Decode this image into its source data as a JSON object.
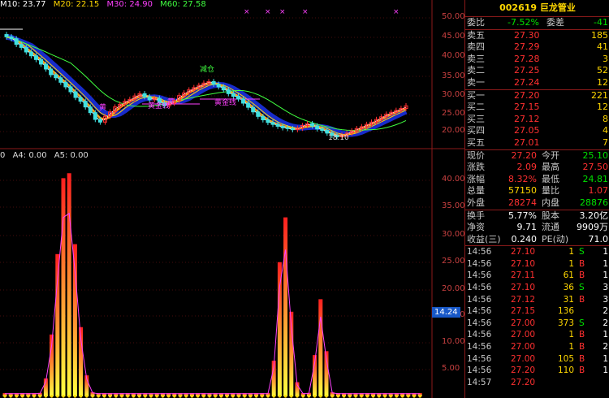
{
  "ma_legend": [
    {
      "text": "M10: 23.77",
      "color": "#ffffff"
    },
    {
      "text": "M20: 22.15",
      "color": "#ffd700"
    },
    {
      "text": "M30: 24.90",
      "color": "#ff40ff"
    },
    {
      "text": "M60: 27.58",
      "color": "#40ff40"
    }
  ],
  "indicator_legend": [
    {
      "text": "0",
      "color": "#dddddd"
    },
    {
      "text": "A4: 0.00",
      "color": "#dddddd"
    },
    {
      "text": "A5: 0.00",
      "color": "#dddddd"
    }
  ],
  "price_axis": [
    "50.00",
    "45.00",
    "40.00",
    "35.00",
    "30.00",
    "25.00",
    "20.00"
  ],
  "indicator_axis": [
    "40.00",
    "35.00",
    "30.00",
    "25.00",
    "20.00",
    "15.00",
    "10.00",
    "5.00"
  ],
  "cursor_value": "14.24",
  "annotations": {
    "sell_mark": "减仓",
    "gold_a": "黄金线",
    "gold_b": "黄金线",
    "short_a": "黄",
    "short_b": "黄",
    "low_price": "18.10"
  },
  "stock": {
    "code": "002619",
    "name": "巨龙管业"
  },
  "commission": {
    "ratio_label": "委比",
    "ratio_value": "-7.52%",
    "diff_label": "委差",
    "diff_value": "-41"
  },
  "asks": [
    {
      "label": "卖五",
      "price": "27.30",
      "vol": "185"
    },
    {
      "label": "卖四",
      "price": "27.29",
      "vol": "41"
    },
    {
      "label": "卖三",
      "price": "27.28",
      "vol": "3"
    },
    {
      "label": "卖二",
      "price": "27.25",
      "vol": "52"
    },
    {
      "label": "卖一",
      "price": "27.24",
      "vol": "12"
    }
  ],
  "bids": [
    {
      "label": "买一",
      "price": "27.20",
      "vol": "221"
    },
    {
      "label": "买二",
      "price": "27.15",
      "vol": "12"
    },
    {
      "label": "买三",
      "price": "27.12",
      "vol": "8"
    },
    {
      "label": "买四",
      "price": "27.05",
      "vol": "4"
    },
    {
      "label": "买五",
      "price": "27.01",
      "vol": "7"
    }
  ],
  "quote": [
    {
      "l1": "现价",
      "v1": "27.20",
      "c1": "red",
      "l2": "今开",
      "v2": "25.10",
      "c2": "green"
    },
    {
      "l1": "涨跌",
      "v1": "2.09",
      "c1": "red",
      "l2": "最高",
      "v2": "27.50",
      "c2": "red"
    },
    {
      "l1": "涨幅",
      "v1": "8.32%",
      "c1": "red",
      "l2": "最低",
      "v2": "24.81",
      "c2": "green"
    },
    {
      "l1": "总量",
      "v1": "57150",
      "c1": "yellow",
      "l2": "量比",
      "v2": "1.07",
      "c2": "red"
    },
    {
      "l1": "外盘",
      "v1": "28274",
      "c1": "red",
      "l2": "内盘",
      "v2": "28876",
      "c2": "green"
    }
  ],
  "fundamentals": [
    {
      "l1": "换手",
      "v1": "5.77%",
      "l2": "股本",
      "v2": "3.20亿"
    },
    {
      "l1": "净资",
      "v1": "9.71",
      "l2": "流通",
      "v2": "9909万"
    },
    {
      "l1": "收益(三)",
      "v1": "0.240",
      "l2": "PE(动)",
      "v2": "71.0"
    }
  ],
  "trades": [
    {
      "time": "14:56",
      "price": "27.10",
      "vol": "1",
      "side": "S",
      "n": "1"
    },
    {
      "time": "14:56",
      "price": "27.10",
      "vol": "1",
      "side": "B",
      "n": "1"
    },
    {
      "time": "14:56",
      "price": "27.11",
      "vol": "61",
      "side": "B",
      "n": "1"
    },
    {
      "time": "14:56",
      "price": "27.10",
      "vol": "36",
      "side": "S",
      "n": "3"
    },
    {
      "time": "14:56",
      "price": "27.12",
      "vol": "31",
      "side": "B",
      "n": "3"
    },
    {
      "time": "14:56",
      "price": "27.15",
      "vol": "136",
      "side": "",
      "n": "2"
    },
    {
      "time": "14:56",
      "price": "27.00",
      "vol": "373",
      "side": "S",
      "n": "2"
    },
    {
      "time": "14:56",
      "price": "27.00",
      "vol": "1",
      "side": "B",
      "n": "1"
    },
    {
      "time": "14:56",
      "price": "27.00",
      "vol": "1",
      "side": "B",
      "n": "2"
    },
    {
      "time": "14:56",
      "price": "27.00",
      "vol": "105",
      "side": "B",
      "n": "1"
    },
    {
      "time": "14:56",
      "price": "27.20",
      "vol": "110",
      "side": "B",
      "n": "1"
    },
    {
      "time": "14:57",
      "price": "27.20",
      "vol": "",
      "side": "",
      "n": ""
    }
  ],
  "colors": {
    "rise": "#ff3030",
    "fall": "#00e000",
    "grid": "#8b1a1a",
    "ma_blue": "#1a30e0"
  }
}
